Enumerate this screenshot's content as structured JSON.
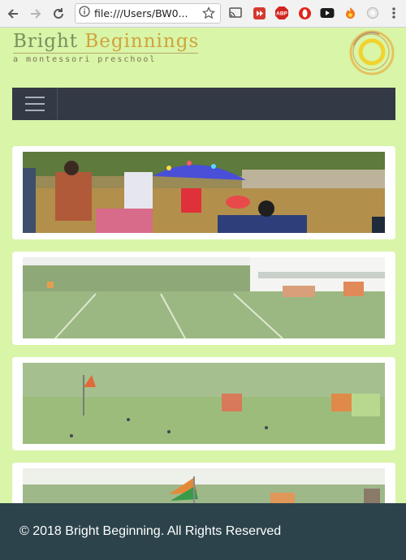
{
  "browser": {
    "url": "file:///Users/BW0...",
    "icons": [
      "back-arrow-icon",
      "forward-arrow-icon",
      "reload-icon",
      "info-icon",
      "star-icon",
      "cast-icon",
      "extension-red-icon",
      "adblock-icon",
      "opera-icon",
      "youtube-icon",
      "firefox-extension-icon",
      "circle-extension-icon",
      "menu-dots-icon"
    ],
    "adblock_label": "ABP"
  },
  "brand": {
    "title_part1": "Bright",
    "title_part2": "Beginnings",
    "tagline": "a montessori preschool"
  },
  "navbar": {
    "background": "#343a45"
  },
  "gallery": {
    "photos": [
      "children-umbrella-photo",
      "sports-field-photo",
      "sports-day-flag-photo",
      "flag-field-photo"
    ]
  },
  "footer": {
    "copyright": "© 2018 Bright Beginning. All Rights Reserved"
  },
  "colors": {
    "page_background": "#d8f5a8",
    "footer_background": "#2c434b",
    "brand_green": "#7b8f5e",
    "brand_gold": "#d1a33c"
  }
}
